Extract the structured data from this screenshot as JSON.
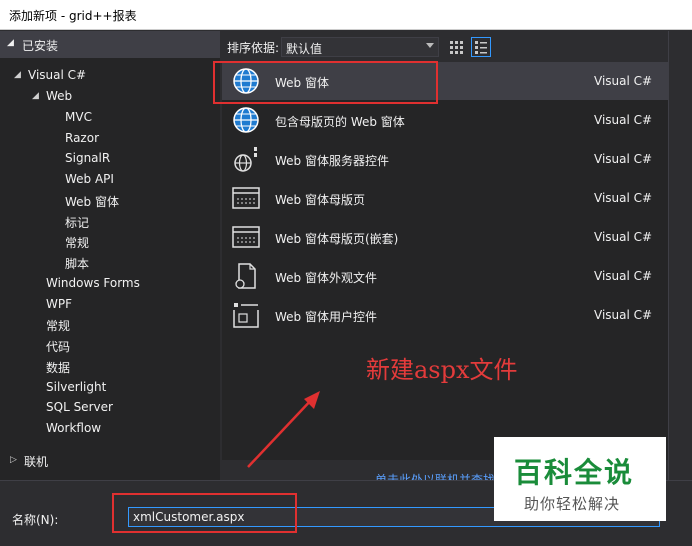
{
  "window": {
    "title": "添加新项 - grid++报表"
  },
  "left_header": {
    "label": "已安装"
  },
  "tree": [
    {
      "label": "Visual C#",
      "expanded": true
    },
    {
      "label": "Web",
      "expanded": true
    },
    {
      "label": "MVC"
    },
    {
      "label": "Razor"
    },
    {
      "label": "SignalR"
    },
    {
      "label": "Web API"
    },
    {
      "label": "Web 窗体",
      "selected": true
    },
    {
      "label": "标记"
    },
    {
      "label": "常规"
    },
    {
      "label": "脚本"
    },
    {
      "label": "Windows Forms"
    },
    {
      "label": "WPF"
    },
    {
      "label": "常规"
    },
    {
      "label": "代码"
    },
    {
      "label": "数据"
    },
    {
      "label": "Silverlight"
    },
    {
      "label": "SQL Server"
    },
    {
      "label": "Workflow"
    },
    {
      "label": "联机",
      "expanded": false
    }
  ],
  "sortbar": {
    "label": "排序依据:",
    "value": "默认值"
  },
  "templates": [
    {
      "name": "Web 窗体",
      "lang": "Visual C#",
      "icon": "globe-icon",
      "selected": true
    },
    {
      "name": "包含母版页的 Web 窗体",
      "lang": "Visual C#",
      "icon": "globe-icon"
    },
    {
      "name": "Web 窗体服务器控件",
      "lang": "Visual C#",
      "icon": "server-control-icon"
    },
    {
      "name": "Web 窗体母版页",
      "lang": "Visual C#",
      "icon": "master-page-icon"
    },
    {
      "name": "Web 窗体母版页(嵌套)",
      "lang": "Visual C#",
      "icon": "nested-master-page-icon"
    },
    {
      "name": "Web 窗体外观文件",
      "lang": "Visual C#",
      "icon": "skin-file-icon"
    },
    {
      "name": "Web 窗体用户控件",
      "lang": "Visual C#",
      "icon": "user-control-icon"
    }
  ],
  "annotation": {
    "text": "新建aspx文件"
  },
  "online_link": {
    "text": "单击此处以联机并查找"
  },
  "bottom": {
    "name_label": "名称(N):",
    "name_value": "xmlCustomer.aspx"
  },
  "watermark": {
    "title": "百科全说",
    "subtitle": "助你轻松解决"
  },
  "colors": {
    "accent": "#3399ff",
    "annotation": "#e03030",
    "watermark_green": "#1a8c3a"
  }
}
